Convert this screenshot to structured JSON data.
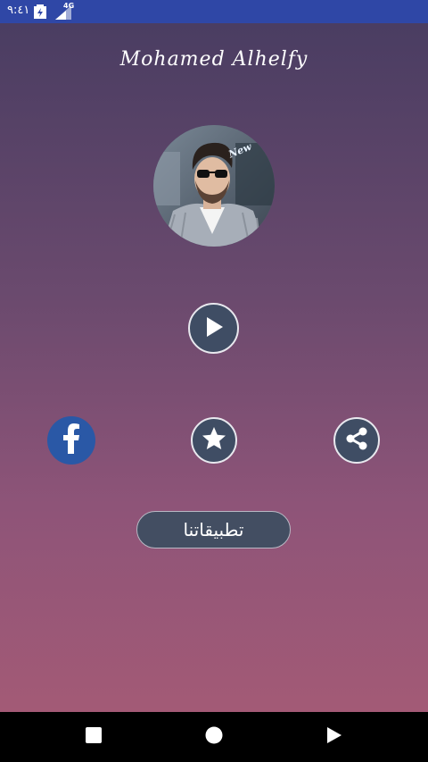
{
  "status_bar": {
    "time": "٩:٤١",
    "network": "4G",
    "icons": [
      "battery-charging-icon",
      "signal-icon"
    ]
  },
  "app": {
    "title": "Mohamed Alhelfy",
    "avatar_badge": "New",
    "buttons": {
      "play": "play-icon",
      "facebook": "facebook-icon",
      "rate": "star-icon",
      "share": "share-icon"
    },
    "our_apps_label": "تطبيقاتنا"
  },
  "nav": {
    "items": [
      "recents-square-icon",
      "home-circle-icon",
      "back-triangle-icon"
    ]
  },
  "colors": {
    "status_bar": "#2f47a6",
    "gradient_top": "#4a3d62",
    "gradient_bottom": "#a35a76",
    "button_fill": "#3f4d64",
    "facebook_blue": "#2a58a6"
  }
}
